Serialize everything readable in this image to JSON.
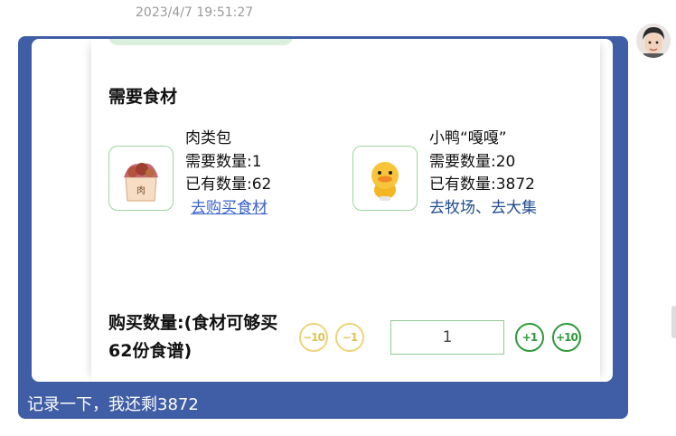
{
  "message": {
    "timestamp": "2023/4/7 19:51:27",
    "caption": "记录一下，我还剩3872"
  },
  "card": {
    "section_title": "需要食材",
    "ingredients": [
      {
        "name": "肉类包",
        "required": "需要数量:1",
        "owned": "已有数量:62",
        "action": "去购买食材",
        "icon": "meat-package-icon",
        "icon_label": "肉"
      },
      {
        "name": "小鸭“嘎嘎”",
        "required": "需要数量:20",
        "owned": "已有数量:3872",
        "action": "去牧场、去大集",
        "icon": "duck-icon"
      }
    ],
    "purchase_label": "购买数量:(食材可够买62份食谱)",
    "buttons": {
      "minus10": "−10",
      "minus1": "−1",
      "plus1": "+1",
      "plus10": "+10"
    },
    "quantity": "1"
  },
  "colors": {
    "bubble": "#3f5ea5",
    "link": "#3a62c9",
    "increment": "#2e9a3b",
    "decrement": "#ecd57a",
    "border_green": "#9fd59f"
  }
}
